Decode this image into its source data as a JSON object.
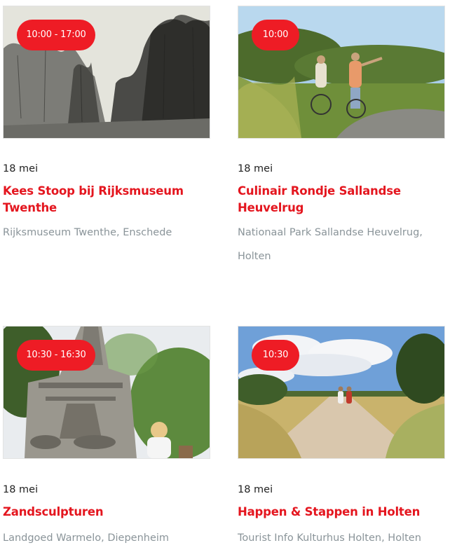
{
  "events": [
    {
      "time": "10:00 - 17:00",
      "date": "18 mei",
      "title": "Kees Stoop bij Rijksmuseum Twenthe",
      "location": "Rijksmuseum Twenthe, Enschede"
    },
    {
      "time": "10:00",
      "date": "18 mei",
      "title": "Culinair Rondje Sallandse Heuvelrug",
      "location": "Nationaal Park Sallandse Heuvelrug, Holten"
    },
    {
      "time": "10:30 - 16:30",
      "date": "18 mei",
      "title": "Zandsculpturen",
      "location": "Landgoed Warmelo, Diepenheim"
    },
    {
      "time": "10:30",
      "date": "18 mei",
      "title": "Happen & Stappen in Holten",
      "location": "Tourist Info Kulturhus Holten, Holten"
    }
  ],
  "colors": {
    "accent": "#e4161f",
    "badge": "#ee1c25",
    "location_text": "#8a9499",
    "date_text": "#222222"
  }
}
